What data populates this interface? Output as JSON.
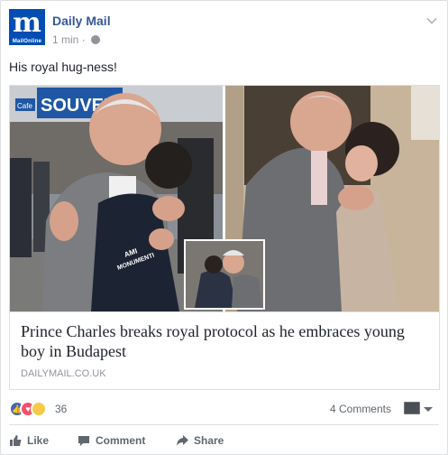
{
  "post": {
    "page_name": "Daily Mail",
    "avatar_glyph": "m",
    "avatar_subtext": "MailOnline",
    "time": "1 min",
    "separator": "·",
    "text": "His royal hug-ness!"
  },
  "link": {
    "headline": "Prince Charles breaks royal protocol as he embraces young boy in Budapest",
    "domain": "DAILYMAIL.CO.UK",
    "image_signs": {
      "souvenir": "SOUVEN",
      "cafe": "Cafe",
      "shirt_text": "AMI\nMONUMENTI"
    }
  },
  "reactions": {
    "count": "36",
    "comments": "4 Comments",
    "types": [
      "like",
      "love",
      "haha"
    ]
  },
  "actions": {
    "like": "Like",
    "comment": "Comment",
    "share": "Share"
  },
  "colors": {
    "brand_blue": "#365899",
    "avatar_blue": "#004db3",
    "meta_gray": "#90949c",
    "like_blue": "#4267b2",
    "love_red": "#f25268",
    "haha_yellow": "#f7c948"
  },
  "icons": {
    "privacy": "globe-icon",
    "menu": "chevron-down-icon",
    "like": "thumbs-up-icon",
    "comment": "speech-bubble-icon",
    "share": "share-arrow-icon",
    "viewer": "profile-thumbnail-icon"
  }
}
